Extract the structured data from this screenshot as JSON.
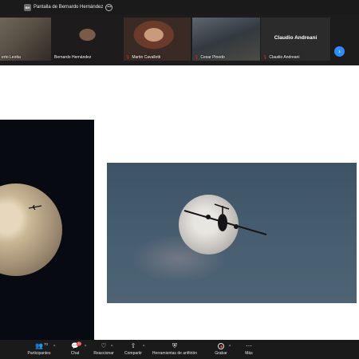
{
  "topbar": {
    "share_badge": "BH",
    "share_label": "Pantalla de Bernardo Hernández",
    "menu_icon": "ellipsis-icon"
  },
  "participants": [
    {
      "name": "erto Leotta",
      "muted": false
    },
    {
      "name": "Bernardo Hernández",
      "muted": false,
      "active": true
    },
    {
      "name": "Martin Cavallotti",
      "muted": true
    },
    {
      "name": "Cesar Pinedo",
      "muted": true
    },
    {
      "name": "Claudio Andreani",
      "muted": true,
      "video_off": true
    }
  ],
  "toolbar": {
    "participants_label": "Participantes",
    "participants_count": "70",
    "chat_label": "Chat",
    "chat_badge": "20",
    "react_label": "Reaccionar",
    "share_label": "Compartir",
    "host_tools_label": "Herramientas de anfitrión",
    "record_label": "Grabar",
    "more_label": "Más"
  },
  "colors": {
    "accent": "#2d8cff",
    "active_speaker": "#24c04a",
    "muted": "#e23a3a",
    "bar": "#1a1a1a"
  }
}
